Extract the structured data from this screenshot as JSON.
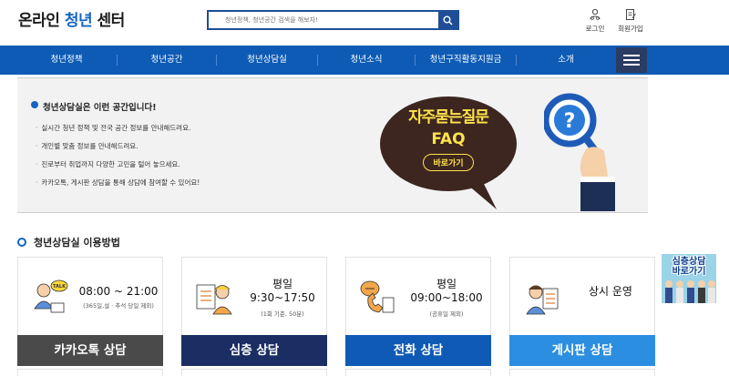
{
  "header": {
    "logo_prefix": "온라인 ",
    "logo_highlight": "청년",
    "logo_suffix": " 센터",
    "search_placeholder": "청년정책, 청년공간 검색을 해보자!",
    "login_label": "로그인",
    "join_label": "회원가입"
  },
  "nav": {
    "items": [
      "청년정책",
      "청년공간",
      "청년상담실",
      "청년소식",
      "청년구직활동지원금",
      "소개"
    ]
  },
  "info": {
    "title": "청년상담실은 이런 공간입니다!",
    "bullets": [
      "실시간 청년 정책 및 전국 공간 정보를 안내해드려요.",
      "개인별 맞춤 정보를 안내해드려요.",
      "진로부터 취업까지 다양한 고민을 털어 놓으세요.",
      "카카오톡, 게시판 상담을 통해 상담에 참여할 수 있어요!"
    ],
    "faq": {
      "title": "자주묻는질문",
      "subtitle": "FAQ",
      "go_label": "바로가기"
    }
  },
  "usage": {
    "title": "청년상담실 이용방법",
    "cards": [
      {
        "line1": "08:00 ~ 21:00",
        "line2": "",
        "note": "(365일,설 · 추석 당일 제외)",
        "button": "카카오톡 상담",
        "color": "#4a4a4a",
        "icon": "talk-bubble-icon"
      },
      {
        "line1": "평일",
        "line2": "9:30~17:50",
        "note": "(1회 기준, 50분)",
        "button": "심층 상담",
        "color": "#1b2e63",
        "icon": "counselor-icon"
      },
      {
        "line1": "평일",
        "line2": "09:00~18:00",
        "note": "(공휴일 제외)",
        "button": "전화 상담",
        "color": "#0f5ab5",
        "icon": "phone-icon"
      },
      {
        "line1": "상시 운영",
        "line2": "",
        "note": "",
        "button": "게시판 상담",
        "color": "#2b8ee0",
        "icon": "board-icon"
      }
    ]
  },
  "banner": {
    "line1": "심층상담",
    "line2": "바로가기"
  }
}
